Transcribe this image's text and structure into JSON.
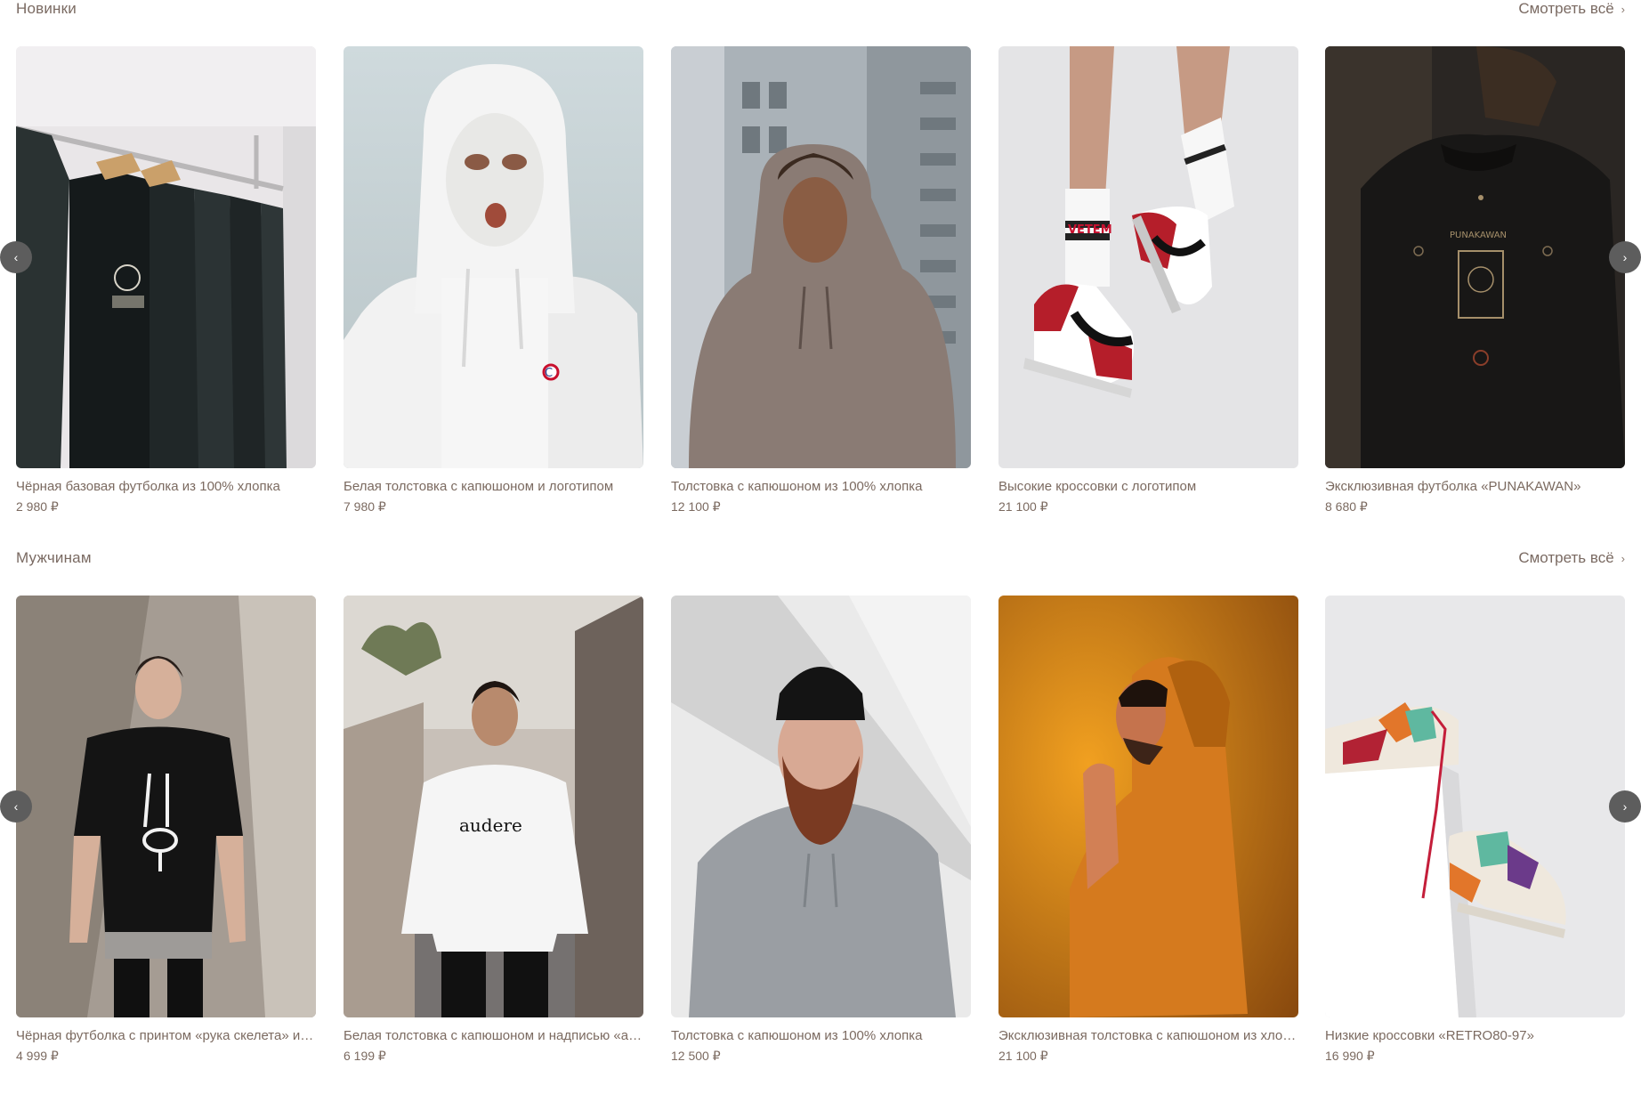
{
  "sections": [
    {
      "title": "Новинки",
      "see_all": "Смотреть всё",
      "products": [
        {
          "name": "Чёрная базовая футболка из 100% хлопка",
          "price": "2 980 ₽"
        },
        {
          "name": "Белая толстовка с капюшоном и логотипом",
          "price": "7 980 ₽"
        },
        {
          "name": "Толстовка с капюшоном из 100% хлопка",
          "price": "12 100 ₽"
        },
        {
          "name": "Высокие кроссовки с логотипом",
          "price": "21 100 ₽"
        },
        {
          "name": "Эксклюзивная футболка «PUNAKAWAN»",
          "price": "8 680 ₽"
        }
      ]
    },
    {
      "title": "Мужчинам",
      "see_all": "Смотреть всё",
      "products": [
        {
          "name": "Чёрная футболка с принтом «рука скелета» и надписью",
          "price": "4 999 ₽"
        },
        {
          "name": "Белая толстовка с капюшоном и надписью «audere»",
          "price": "6 199 ₽"
        },
        {
          "name": "Толстовка с капюшоном из 100% хлопка",
          "price": "12 500 ₽"
        },
        {
          "name": "Эксклюзивная толстовка с капюшоном из хлопка",
          "price": "21 100 ₽"
        },
        {
          "name": "Низкие кроссовки «RETRO80-97»",
          "price": "16 990 ₽"
        }
      ]
    }
  ],
  "image_texts": {
    "champion_mask": "C",
    "socks_print": "VETEM",
    "shirt_print": "PUNAKAWAN",
    "hoodie_print": "audere"
  },
  "icons": {
    "prev": "chevron-left-icon",
    "next": "chevron-right-icon"
  }
}
